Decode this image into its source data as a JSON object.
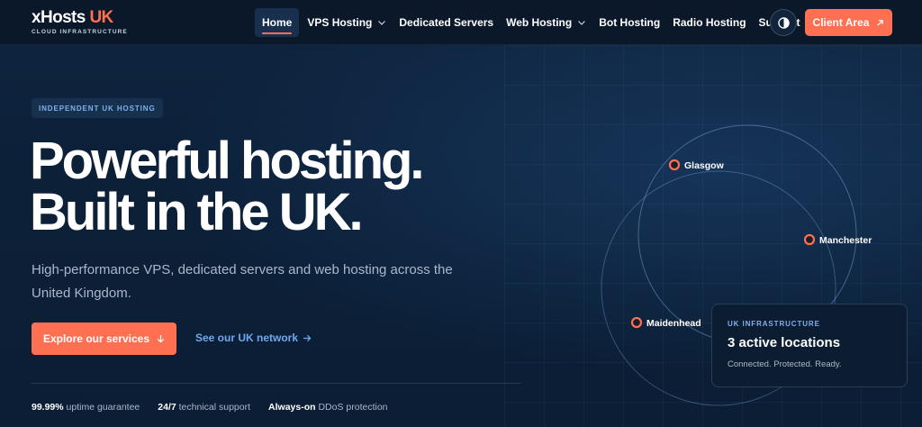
{
  "logo": {
    "name_part1": "xHosts ",
    "name_part2": "UK",
    "subtitle": "CLOUD INFRASTRUCTURE"
  },
  "nav": {
    "items": [
      {
        "label": "Home",
        "active": true,
        "has_dropdown": false
      },
      {
        "label": "VPS Hosting",
        "active": false,
        "has_dropdown": true
      },
      {
        "label": "Dedicated Servers",
        "active": false,
        "has_dropdown": false
      },
      {
        "label": "Web Hosting",
        "active": false,
        "has_dropdown": true
      },
      {
        "label": "Bot Hosting",
        "active": false,
        "has_dropdown": false
      },
      {
        "label": "Radio Hosting",
        "active": false,
        "has_dropdown": false
      },
      {
        "label": "Support",
        "active": false,
        "has_dropdown": false
      }
    ],
    "client_area_label": "Client Area",
    "client_area_icon": "arrow-up-right-icon",
    "theme_toggle_icon": "contrast-icon"
  },
  "hero": {
    "badge": "INDEPENDENT UK HOSTING",
    "headline_line1": "Powerful hosting.",
    "headline_line2": "Built in the UK.",
    "subtext": "High-performance VPS, dedicated servers and web hosting across the United Kingdom.",
    "cta_primary": "Explore our services",
    "cta_primary_icon": "arrow-down-icon",
    "cta_secondary": "See our UK network",
    "cta_secondary_icon": "arrow-right-icon"
  },
  "stats": [
    {
      "value": "99.99%",
      "label": " uptime guarantee"
    },
    {
      "value": "24/7",
      "label": " technical support"
    },
    {
      "value": "Always-on",
      "label": " DDoS protection"
    }
  ],
  "map": {
    "locations": [
      {
        "name": "Glasgow"
      },
      {
        "name": "Manchester"
      },
      {
        "name": "Maidenhead"
      }
    ],
    "card": {
      "kicker": "UK INFRASTRUCTURE",
      "title": "3 active locations",
      "description": "Connected. Protected. Ready."
    }
  },
  "colors": {
    "accent": "#ff6f52",
    "background": "#0c2038",
    "header_bg": "#0a1829",
    "link": "#6fa8ef",
    "muted_text": "#aab8c9"
  }
}
